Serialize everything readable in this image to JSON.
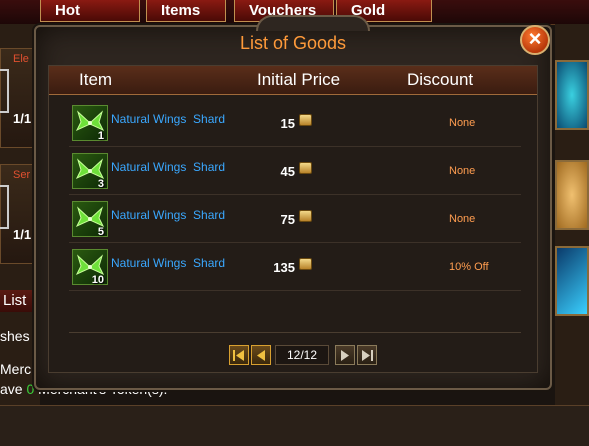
{
  "bg": {
    "tabs": [
      "Hot",
      "Items",
      "Vouchers",
      "Gold Shop"
    ],
    "card1_label": "Ele",
    "card1_count": "1/1",
    "card2_label": "Ser",
    "card2_count": "1/1",
    "list_label": "List",
    "line1": "shes",
    "line2": "Merch",
    "line3_pre": "ave ",
    "line3_num": "0",
    "line3_post": " Merchant's Token(s)."
  },
  "dialog": {
    "title": "List of Goods",
    "close_glyph": "×",
    "headers": {
      "item": "Item",
      "price": "Initial Price",
      "discount": "Discount"
    },
    "rows": [
      {
        "name": "Natural Wings  Shard",
        "qty": "1",
        "price": "15",
        "discount": "None"
      },
      {
        "name": "Natural Wings  Shard",
        "qty": "3",
        "price": "45",
        "discount": "None"
      },
      {
        "name": "Natural Wings  Shard",
        "qty": "5",
        "price": "75",
        "discount": "None"
      },
      {
        "name": "Natural Wings  Shard",
        "qty": "10",
        "price": "135",
        "discount": "10% Off"
      }
    ],
    "pager": {
      "indicator": "12/12"
    }
  },
  "icons": {
    "item": "green-wings-shard-icon",
    "currency": "gold-ticket-icon",
    "first": "first-page-icon",
    "prev": "prev-page-icon",
    "next": "next-page-icon",
    "last": "last-page-icon"
  },
  "colors": {
    "title": "#ff9a3a",
    "item_name": "#3aa8ff",
    "discount": "#ff9d50",
    "header_bg": "#5a2e1a"
  }
}
